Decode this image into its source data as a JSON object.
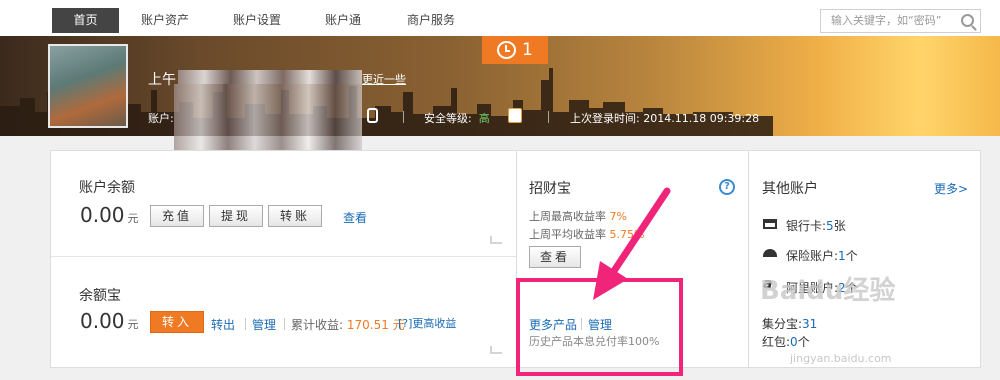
{
  "nav": {
    "tabs": [
      {
        "label": "首页",
        "active": true
      },
      {
        "label": "账户资产"
      },
      {
        "label": "账户设置"
      },
      {
        "label": "账户通"
      },
      {
        "label": "商户服务"
      }
    ],
    "search_placeholder": "输入关键字，如“密码”"
  },
  "banner": {
    "notification_count": "1",
    "greeting": "上午",
    "greeting_link": "更近一些",
    "account_label": "账户:",
    "security_label": "安全等级:",
    "security_level": "高",
    "last_login_label": "上次登录时间:",
    "last_login_time": "2014.11.18 09:39:28"
  },
  "balance": {
    "title": "账户余额",
    "amount": "0.00",
    "unit": "元",
    "buttons": [
      "充值",
      "提现",
      "转账"
    ],
    "view_link": "查看"
  },
  "yuebao": {
    "title": "余额宝",
    "amount": "0.00",
    "unit": "元",
    "transfer_in": "转入",
    "transfer_out": "转出",
    "manage": "管理",
    "income_label": "累计收益:",
    "income_value": "170.51 元",
    "more_income": "[?]更高收益"
  },
  "zhaocaibao": {
    "title": "招财宝",
    "help": "?",
    "weekly_max_label": "上周最高收益率",
    "weekly_max_value": "7%",
    "weekly_avg_label": "上周平均收益率",
    "weekly_avg_value": "5.75%",
    "view_button": "查看",
    "more_products": "更多产品",
    "manage": "管理",
    "history_note": "历史产品本息兑付率100%"
  },
  "other_accounts": {
    "title": "其他账户",
    "more": "更多>",
    "items": [
      {
        "icon": "bank-card-icon",
        "label": "银行卡:",
        "count": "5",
        "unit": "张"
      },
      {
        "icon": "umbrella-icon",
        "label": "保险账户:",
        "count": "1",
        "unit": "个"
      },
      {
        "icon": "alibaba-icon",
        "label": "阿里账户:",
        "count": "2",
        "unit": "个"
      }
    ],
    "points_label": "集分宝:",
    "points_value": "31",
    "redpacket_label": "红包:",
    "redpacket_value": "0",
    "redpacket_unit": "个"
  },
  "watermark": {
    "logo": "Baidu经验",
    "url": "jingyan.baidu.com"
  }
}
